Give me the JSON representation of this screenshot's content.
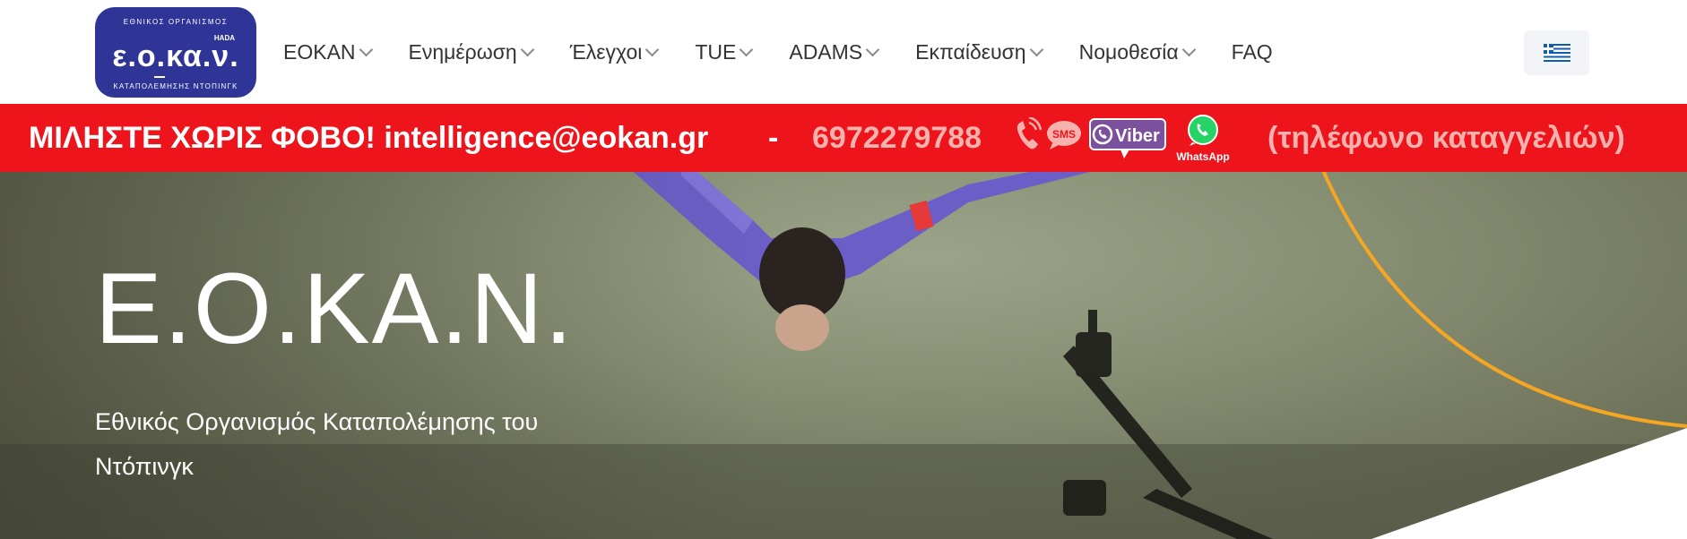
{
  "logo": {
    "top_text": "ΕΘΝΙΚΟΣ ΟΡΓΑΝΙΣΜΟΣ",
    "corner_text": "HADA",
    "main_text": "ε.ο.κα.ν.",
    "bottom_text": "ΚΑΤΑΠΟΛΕΜΗΣΗΣ ΝΤΟΠΙΝΓΚ",
    "bg_color": "#2e3596"
  },
  "nav": {
    "items": [
      {
        "label": "ΕΟΚΑΝ",
        "has_dropdown": true
      },
      {
        "label": "Ενημέρωση",
        "has_dropdown": true
      },
      {
        "label": "Έλεγχοι",
        "has_dropdown": true
      },
      {
        "label": "TUE",
        "has_dropdown": true
      },
      {
        "label": "ADAMS",
        "has_dropdown": true
      },
      {
        "label": "Εκπαίδευση",
        "has_dropdown": true
      },
      {
        "label": "Νομοθεσία",
        "has_dropdown": true
      },
      {
        "label": "FAQ",
        "has_dropdown": false
      }
    ],
    "language_icon": "greek-flag-icon"
  },
  "banner": {
    "main_text": "ΜΙΛΗΣΤΕ ΧΩΡΙΣ ΦΟΒΟ! intelligence@eokan.gr",
    "separator": "-",
    "phone": "6972279788",
    "sms_label": "SMS",
    "viber_label": "Viber",
    "whatsapp_label": "WhatsApp",
    "note": "(τηλέφωνο καταγγελιών)",
    "bg_color": "#ee141c"
  },
  "hero": {
    "title": "Ε.Ο.ΚΑ.Ν.",
    "subtitle_line1": "Εθνικός Οργανισμός Καταπολέμησης του",
    "subtitle_line2": "Ντόπινγκ",
    "accent_color": "#f5a623"
  }
}
